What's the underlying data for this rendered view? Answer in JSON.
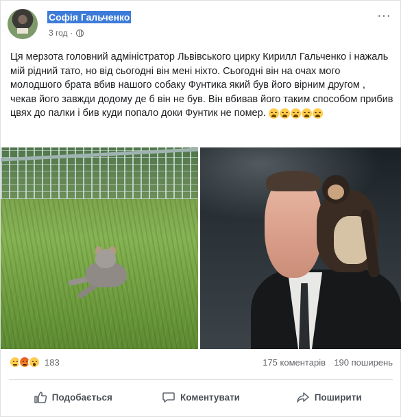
{
  "post": {
    "author": "Софія Гальченко",
    "timestamp": "3 год",
    "more_icon": "ellipsis-icon",
    "privacy_icon": "globe-icon",
    "text": "Ця мерзота головний адміністратор Львівського цирку Кирилл Гальченко і нажаль мій рідний тато, но від сьогодні він мені ніхто. Сьогодні він на очах мого молодшого брата вбив нашого собаку Фунтика який був його вірним другом , чекав його завжди додому де б він не був. Він вбивав його таким способом прибив цвях до палки і бив куди попало доки Фунтик не помер.",
    "emoji_icons": [
      "crying-face-icon",
      "crying-face-icon",
      "crying-face-icon",
      "crying-face-icon",
      "crying-face-icon"
    ],
    "photos": [
      {
        "name": "dog-photo"
      },
      {
        "name": "man-with-monkey-photo"
      }
    ]
  },
  "stats": {
    "reaction_icons": [
      "sad-reaction-icon",
      "angry-reaction-icon",
      "wow-reaction-icon"
    ],
    "reactions_count": "183",
    "comments": "175 коментарів",
    "shares": "190 поширень"
  },
  "actions": {
    "like": "Подобається",
    "comment": "Коментувати",
    "share": "Поширити"
  },
  "colors": {
    "name_highlight": "#3d7bd9",
    "secondary_text": "#65676b",
    "action_text": "#4b4f56"
  }
}
